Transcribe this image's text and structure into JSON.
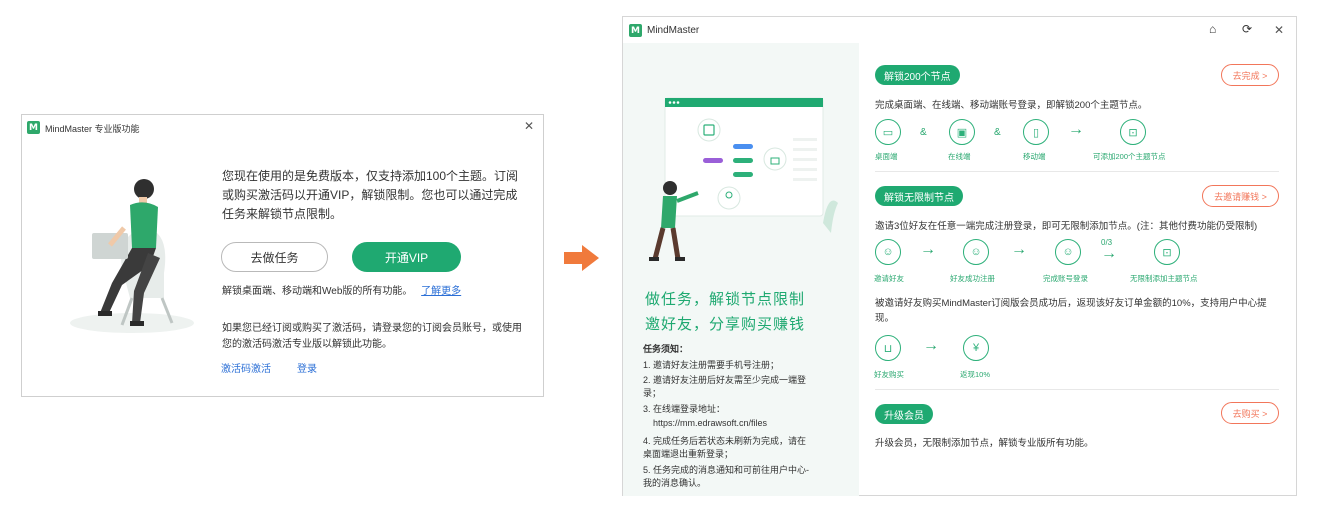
{
  "dialog": {
    "title": "MindMaster 专业版功能",
    "description": "您现在使用的是免费版本，仅支持添加100个主题。订阅或购买激活码以开通VIP，解锁限制。您也可以通过完成任务来解锁节点限制。",
    "btn_task": "去做任务",
    "btn_vip": "开通VIP",
    "unlock_text": "解锁桌面端、移动端和Web版的所有功能。",
    "learn_more": "了解更多",
    "login_hint": "如果您已经订阅或购买了激活码，请登录您的订阅会员账号，或使用您的激活码激活专业版以解锁此功能。",
    "activate_link": "激活码激活",
    "login_link": "登录"
  },
  "window": {
    "title": "MindMaster",
    "promo_line1": "做任务，解锁节点限制",
    "promo_line2": "邀好友，分享购买赚钱",
    "tasks_title": "任务须知：",
    "tasks": [
      "1. 邀请好友注册需要手机号注册；",
      "2. 邀请好友注册后好友需至少完成一端登录；",
      "3. 在线端登录地址：",
      "https://mm.edrawsoft.cn/files",
      "4. 完成任务后若状态未刷新为完成，请在桌面端退出重新登录；",
      "5. 任务完成的消息通知和可前往用户中心-我的消息确认。"
    ],
    "sections": [
      {
        "tag": "解锁200个节点",
        "button": "去完成 >",
        "desc": "完成桌面端、在线端、移动端账号登录，即解锁200个主题节点。",
        "steps": [
          "桌面端",
          "在线端",
          "移动端",
          "可添加200个主题节点"
        ]
      },
      {
        "tag": "解锁无限制节点",
        "button": "去邀请赚钱 >",
        "desc": "邀请3位好友在任意一端完成注册登录，即可无限制添加节点。(注：其他付费功能仍受限制)",
        "steps": [
          "邀请好友",
          "好友成功注册",
          "完成账号登录",
          "无限制添加主题节点"
        ],
        "progress": "0/3",
        "desc2": "被邀请好友购买MindMaster订阅版会员成功后，返现该好友订单金额的10%，支持用户中心提现。",
        "steps2": [
          "好友购买",
          "返现10%"
        ]
      },
      {
        "tag": "升级会员",
        "button": "去购买 >",
        "desc": "升级会员，无限制添加节点，解锁专业版所有功能。"
      }
    ]
  },
  "colors": {
    "brand_green": "#1fa971",
    "accent_orange": "#f2765a",
    "link_blue": "#2b6fd6"
  }
}
